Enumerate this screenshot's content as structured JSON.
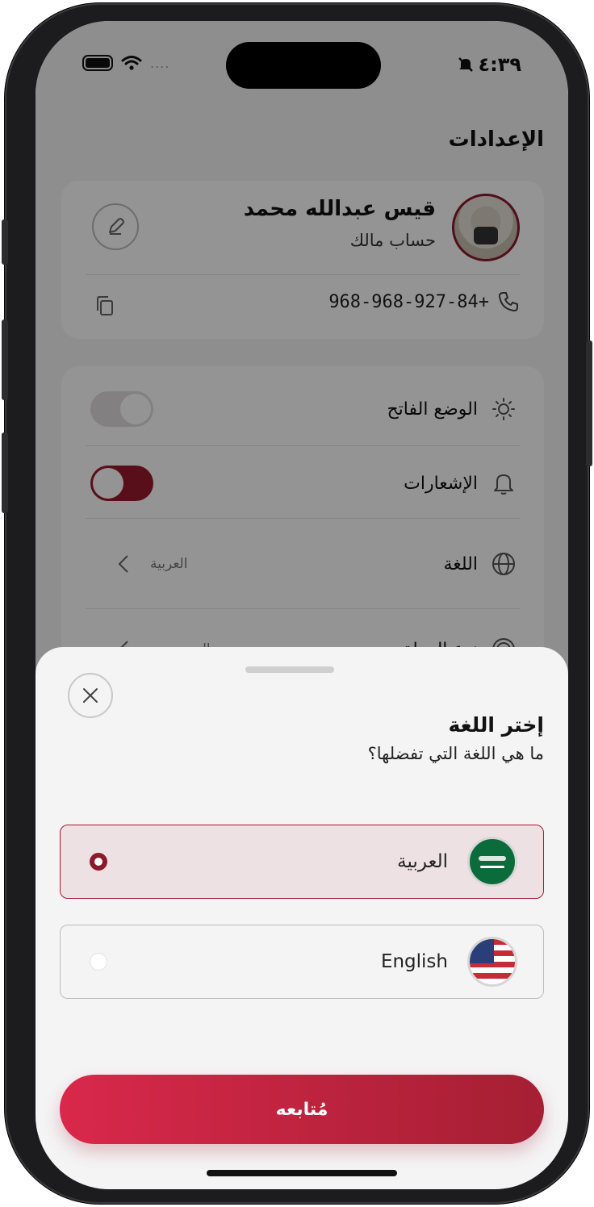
{
  "status_bar": {
    "time": "٤:٣٩",
    "signal_dots": "...."
  },
  "settings": {
    "title": "الإعدادات",
    "profile": {
      "name": "قيس عبدالله محمد",
      "role": "حساب مالك",
      "phone": "968-968-927-84+"
    },
    "rows": [
      {
        "label": "الوضع الفاتح",
        "icon": "sun-icon",
        "type": "toggle",
        "on": false
      },
      {
        "label": "الإشعارات",
        "icon": "bell-icon",
        "type": "toggle",
        "on": true
      },
      {
        "label": "اللغة",
        "icon": "globe-icon",
        "type": "value",
        "value": "العربية"
      },
      {
        "label": "نوع العملة",
        "icon": "currency-icon",
        "type": "value",
        "value": "ريال سعودي"
      }
    ]
  },
  "sheet": {
    "title": "إختر اللغة",
    "subtitle": "ما هي اللغة التي تفضلها؟",
    "options": [
      {
        "label": "العربية",
        "flag": "saudi-flag-icon",
        "selected": true
      },
      {
        "label": "English",
        "flag": "us-flag-icon",
        "selected": false
      }
    ],
    "continue_label": "مُتابعه"
  },
  "colors": {
    "accent": "#a21c32",
    "accent_light": "#ede1e3",
    "background": "#f4f4f5"
  }
}
